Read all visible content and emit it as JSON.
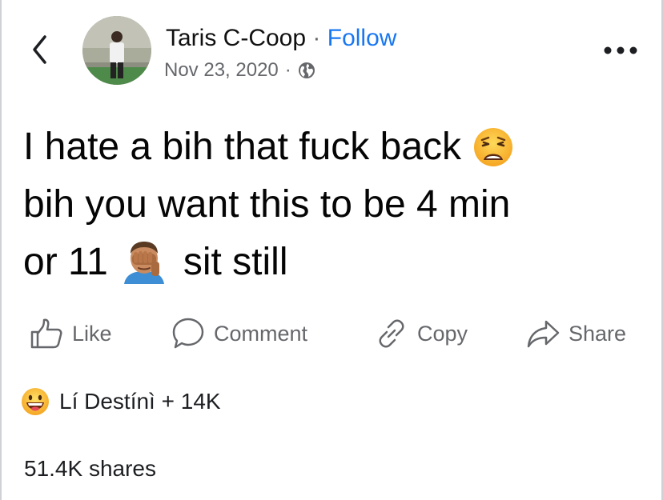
{
  "header": {
    "author_name": "Taris C-Coop",
    "separator": "·",
    "follow_label": "Follow",
    "date": "Nov 23, 2020",
    "meta_separator": "·",
    "privacy_icon": "globe-icon",
    "back_icon": "chevron-left-icon",
    "more_icon": "more-dots-icon"
  },
  "post": {
    "line1": "I hate a bih that fuck back",
    "line1_emoji": "weary-face-emoji",
    "line2": "bih you want this to be 4 min",
    "line3_start": "or 11",
    "line3_emoji": "person-facepalming-emoji",
    "line3_end": "sit still"
  },
  "actions": [
    {
      "label": "Like",
      "icon": "thumbs-up-icon"
    },
    {
      "label": "Comment",
      "icon": "comment-icon"
    },
    {
      "label": "Copy",
      "icon": "link-icon"
    },
    {
      "label": "Share",
      "icon": "share-arrow-icon"
    }
  ],
  "reactions": {
    "emoji": "grinning-face-emoji",
    "text": "Lí Destínì + 14K"
  },
  "shares": {
    "text": "51.4K shares"
  },
  "colors": {
    "link_blue": "#1877f2",
    "secondary_text": "#65676b",
    "primary_text": "#050505"
  }
}
